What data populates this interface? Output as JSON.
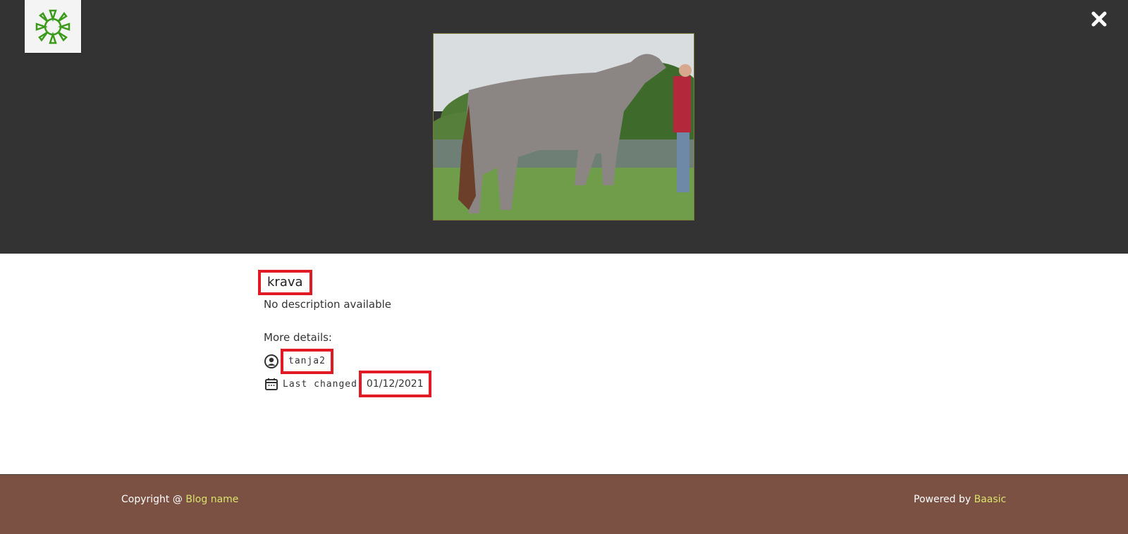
{
  "header": {
    "logo_icon": "sunburst-logo-icon",
    "close_icon": "close-icon"
  },
  "image": {
    "alt": "krava"
  },
  "item": {
    "title": "krava",
    "description": "No description available",
    "more_details_label": "More details:",
    "author": "tanja2",
    "last_changed_label": "Last changed",
    "last_changed_date": "01/12/2021"
  },
  "footer": {
    "copyright_prefix": "Copyright @ ",
    "blog_name": "Blog name",
    "powered_prefix": "Powered by ",
    "powered_link": "Baasic"
  },
  "colors": {
    "header_bg": "#333333",
    "footer_bg": "#7b5144",
    "accent": "#d9e36b",
    "highlight": "#e01b24",
    "logo_green": "#3a9a1a"
  }
}
